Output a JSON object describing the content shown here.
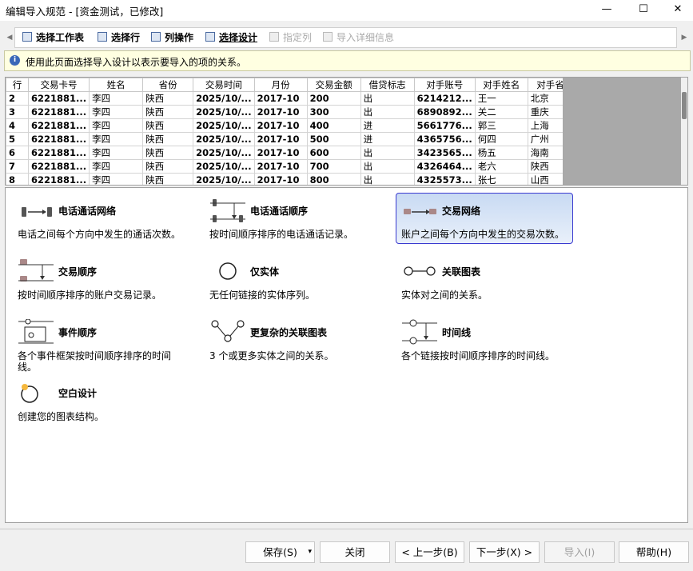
{
  "window": {
    "title": "编辑导入规范 - [资金测试，已修改]",
    "minimize_glyph": "—",
    "maximize_glyph": "☐",
    "close_glyph": "✕"
  },
  "tabs": [
    {
      "label": "选择工作表",
      "state": "normal"
    },
    {
      "label": "选择行",
      "state": "normal"
    },
    {
      "label": "列操作",
      "state": "normal"
    },
    {
      "label": "选择设计",
      "state": "active"
    },
    {
      "label": "指定列",
      "state": "disabled"
    },
    {
      "label": "导入详细信息",
      "state": "disabled"
    }
  ],
  "hint": {
    "icon": "info-icon",
    "text": "使用此页面选择导入设计以表示要导入的项的关系。"
  },
  "grid": {
    "columns": [
      "行",
      "交易卡号",
      "姓名",
      "省份",
      "交易时间",
      "月份",
      "交易金额",
      "借贷标志",
      "对手账号",
      "对手姓名",
      "对手省份"
    ],
    "rows": [
      [
        "2",
        "6221881...",
        "李四",
        "陕西",
        "2025/10/...",
        "2017-10",
        "200",
        "出",
        "6214212...",
        "王一",
        "北京"
      ],
      [
        "3",
        "6221881...",
        "李四",
        "陕西",
        "2025/10/...",
        "2017-10",
        "300",
        "出",
        "6890892...",
        "关二",
        "重庆"
      ],
      [
        "4",
        "6221881...",
        "李四",
        "陕西",
        "2025/10/...",
        "2017-10",
        "400",
        "进",
        "5661776...",
        "郭三",
        "上海"
      ],
      [
        "5",
        "6221881...",
        "李四",
        "陕西",
        "2025/10/...",
        "2017-10",
        "500",
        "进",
        "4365756...",
        "何四",
        "广州"
      ],
      [
        "6",
        "6221881...",
        "李四",
        "陕西",
        "2025/10/...",
        "2017-10",
        "600",
        "出",
        "3423565...",
        "杨五",
        "海南"
      ],
      [
        "7",
        "6221881...",
        "李四",
        "陕西",
        "2025/10/...",
        "2017-10",
        "700",
        "出",
        "4326464...",
        "老六",
        "陕西"
      ],
      [
        "8",
        "6221881...",
        "李四",
        "陕西",
        "2025/10/...",
        "2017-10",
        "800",
        "出",
        "4325573...",
        "张七",
        "山西"
      ]
    ]
  },
  "designs": [
    {
      "name": "电话通话网络",
      "desc": "电话之间每个方向中发生的通话次数。",
      "icon": "phone-network-icon",
      "selected": false
    },
    {
      "name": "电话通话顺序",
      "desc": "按时间顺序排序的电话通话记录。",
      "icon": "phone-sequence-icon",
      "selected": false
    },
    {
      "name": "交易网络",
      "desc": "账户之间每个方向中发生的交易次数。",
      "icon": "transaction-network-icon",
      "selected": true
    },
    {
      "name": "交易顺序",
      "desc": "按时间顺序排序的账户交易记录。",
      "icon": "transaction-sequence-icon",
      "selected": false
    },
    {
      "name": "仅实体",
      "desc": "无任何链接的实体序列。",
      "icon": "entity-only-icon",
      "selected": false
    },
    {
      "name": "关联图表",
      "desc": "实体对之间的关系。",
      "icon": "link-chart-icon",
      "selected": false
    },
    {
      "name": "事件顺序",
      "desc": "各个事件框架按时间顺序排序的时间线。",
      "icon": "event-sequence-icon",
      "selected": false
    },
    {
      "name": "更复杂的关联图表",
      "desc": "3 个或更多实体之间的关系。",
      "icon": "complex-link-chart-icon",
      "selected": false
    },
    {
      "name": "时间线",
      "desc": "各个链接按时间顺序排序的时间线。",
      "icon": "timeline-icon",
      "selected": false
    },
    {
      "name": "空白设计",
      "desc": "创建您的图表结构。",
      "icon": "blank-design-icon",
      "selected": false
    }
  ],
  "buttons": {
    "save": "保存(S)",
    "close": "关闭",
    "prev": "< 上一步(B)",
    "next": "下一步(X) >",
    "import": "导入(I)",
    "help": "帮助(H)"
  }
}
